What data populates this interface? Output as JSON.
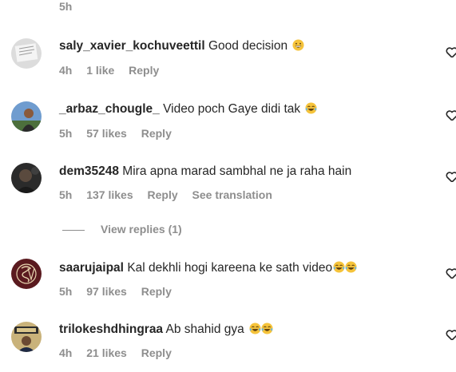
{
  "top_meta": {
    "time": "5h"
  },
  "comments": [
    {
      "username": "saly_xavier_kochuveettil",
      "text": "Good decision",
      "emoji_count": 1,
      "time": "4h",
      "likes": "1 like",
      "reply": "Reply",
      "translation": ""
    },
    {
      "username": "_arbaz_chougle_",
      "text": "Video poch Gaye didi tak",
      "emoji_count": 1,
      "time": "5h",
      "likes": "57 likes",
      "reply": "Reply",
      "translation": ""
    },
    {
      "username": "dem35248",
      "text": "Mira apna marad sambhal ne ja raha hain",
      "emoji_count": 0,
      "time": "5h",
      "likes": "137 likes",
      "reply": "Reply",
      "translation": "See translation"
    },
    {
      "username": "saarujaipal",
      "text": "Kal dekhli hogi kareena ke sath video",
      "emoji_count": 2,
      "time": "5h",
      "likes": "97 likes",
      "reply": "Reply",
      "translation": ""
    },
    {
      "username": "trilokeshdhingraa",
      "text": "Ab shahid gya",
      "emoji_count": 2,
      "time": "4h",
      "likes": "21 likes",
      "reply": "Reply",
      "translation": ""
    }
  ],
  "view_replies": {
    "label": "View replies (1)"
  },
  "icons": {
    "like": "heart-outline-icon",
    "emoji_grin": "grinning-face-icon",
    "emoji_laugh": "tears-of-joy-face-icon"
  },
  "colors": {
    "text": "#262626",
    "secondary": "#8e8e8e",
    "emoji": "#f5c33b"
  }
}
